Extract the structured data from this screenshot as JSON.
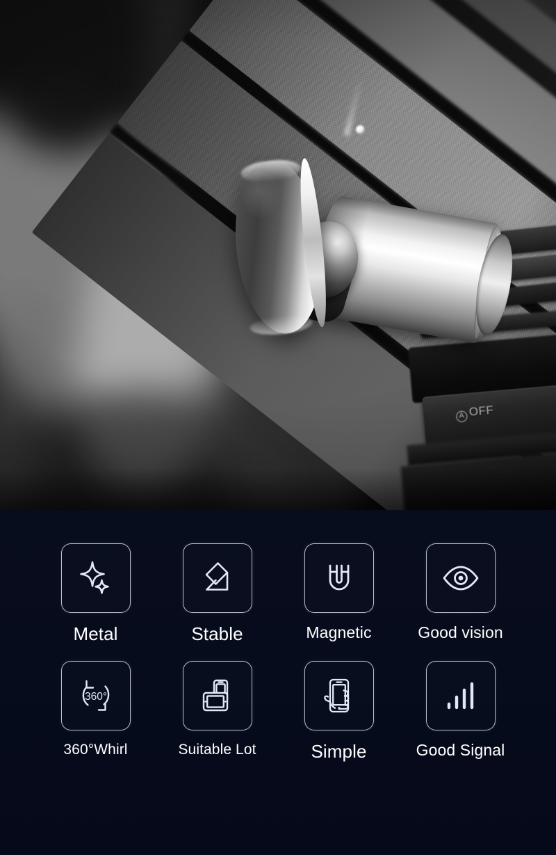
{
  "hero": {
    "alt_description": "Close-up of a silver magnetic car phone holder mounted on a dark car dashboard",
    "dashboard_button_label": "OFF",
    "dashboard_button_symbol": "A"
  },
  "features": {
    "rows": [
      [
        {
          "icon": "sparkle-icon",
          "label": "Metal",
          "size": "normal"
        },
        {
          "icon": "stable-mount-icon",
          "label": "Stable",
          "size": "normal"
        },
        {
          "icon": "magnet-icon",
          "label": "Magnetic",
          "size": "sm"
        },
        {
          "icon": "eye-icon",
          "label": "Good vision",
          "size": "sm"
        }
      ],
      [
        {
          "icon": "rotate-360-icon",
          "label": "360°Whirl",
          "size": "xs"
        },
        {
          "icon": "two-devices-icon",
          "label": "Suitable Lot",
          "size": "xs"
        },
        {
          "icon": "hand-phone-icon",
          "label": "Simple",
          "size": "normal"
        },
        {
          "icon": "signal-bars-icon",
          "label": "Good Signal",
          "size": "sm"
        }
      ]
    ]
  },
  "colors": {
    "panel_background": "#070c1c",
    "icon_stroke": "#e2e8f5",
    "label_text": "#ffffff"
  }
}
